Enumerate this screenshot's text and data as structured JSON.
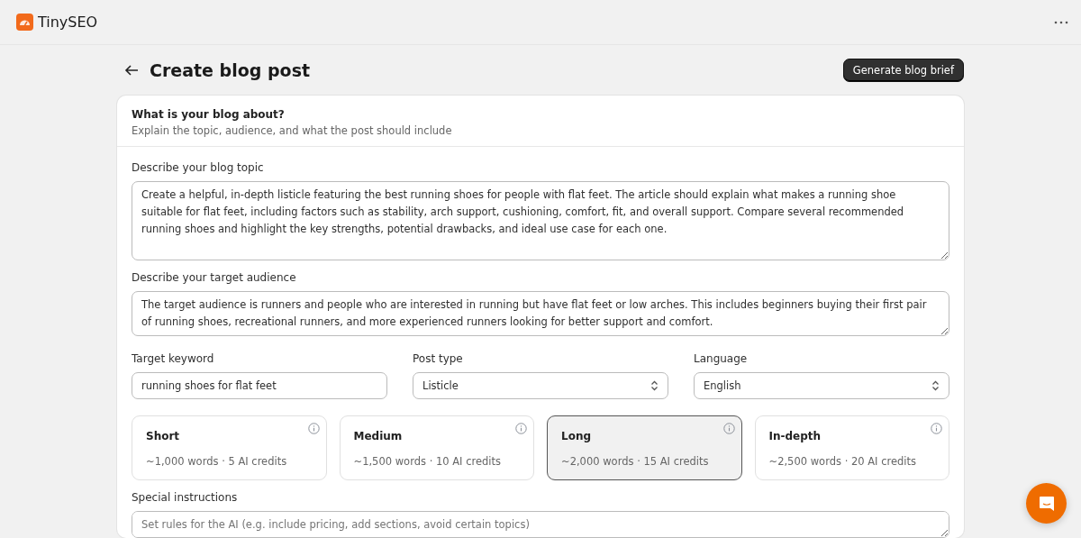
{
  "app": {
    "name": "TinySEO"
  },
  "page": {
    "title": "Create blog post",
    "primary_button": "Generate blog brief"
  },
  "card": {
    "title": "What is your blog about?",
    "subtitle": "Explain the topic, audience, and what the post should include"
  },
  "topic": {
    "label": "Describe your blog topic",
    "value": "Create a helpful, in-depth listicle featuring the best running shoes for people with flat feet. The article should explain what makes a running shoe suitable for flat feet, including factors such as stability, arch support, cushioning, comfort, fit, and overall support. Compare several recommended running shoes and highlight the key strengths, potential drawbacks, and ideal use case for each one."
  },
  "audience": {
    "label": "Describe your target audience",
    "value": "The target audience is runners and people who are interested in running but have flat feet or low arches. This includes beginners buying their first pair of running shoes, recreational runners, and more experienced runners looking for better support and comfort."
  },
  "fields": [
    {
      "kind": "input",
      "label": "Target keyword",
      "value": "running shoes for flat feet"
    },
    {
      "kind": "select",
      "label": "Post type",
      "value": "Listicle"
    },
    {
      "kind": "select",
      "label": "Language",
      "value": "English"
    }
  ],
  "lengths": [
    {
      "name": "Short",
      "detail": "~1,000 words · 5 AI credits",
      "selected": false
    },
    {
      "name": "Medium",
      "detail": "~1,500 words · 10 AI credits",
      "selected": false
    },
    {
      "name": "Long",
      "detail": "~2,000 words · 15 AI credits",
      "selected": true
    },
    {
      "name": "In-depth",
      "detail": "~2,500 words · 20 AI credits",
      "selected": false
    }
  ],
  "special": {
    "label": "Special instructions",
    "placeholder": "Set rules for the AI (e.g. include pricing, add sections, avoid certain topics)"
  }
}
